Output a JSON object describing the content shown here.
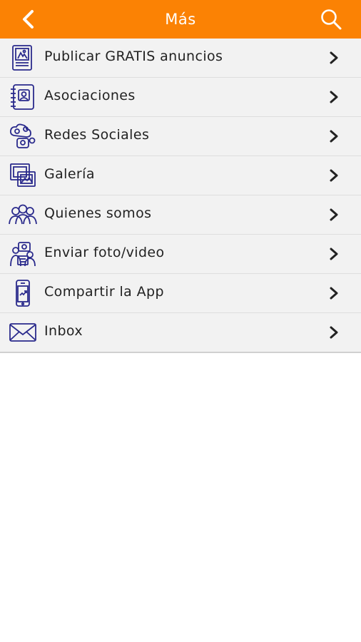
{
  "header": {
    "title": "Más",
    "back_icon": "chevron-left-icon",
    "search_icon": "search-icon"
  },
  "colors": {
    "header_bg": "#fb8204",
    "icon_stroke": "#2a2a8c",
    "list_bg": "#f2f2f2"
  },
  "menu": {
    "items": [
      {
        "label": "Publicar GRATIS anuncios",
        "icon": "newspaper-ad-icon"
      },
      {
        "label": "Asociaciones",
        "icon": "address-book-icon"
      },
      {
        "label": "Redes Sociales",
        "icon": "social-network-icon"
      },
      {
        "label": "Galería",
        "icon": "photo-gallery-icon"
      },
      {
        "label": "Quienes somos",
        "icon": "group-people-icon"
      },
      {
        "label": "Enviar foto/video",
        "icon": "send-media-icon"
      },
      {
        "label": "Compartir la App",
        "icon": "share-phone-icon"
      },
      {
        "label": "Inbox",
        "icon": "envelope-icon"
      }
    ]
  }
}
